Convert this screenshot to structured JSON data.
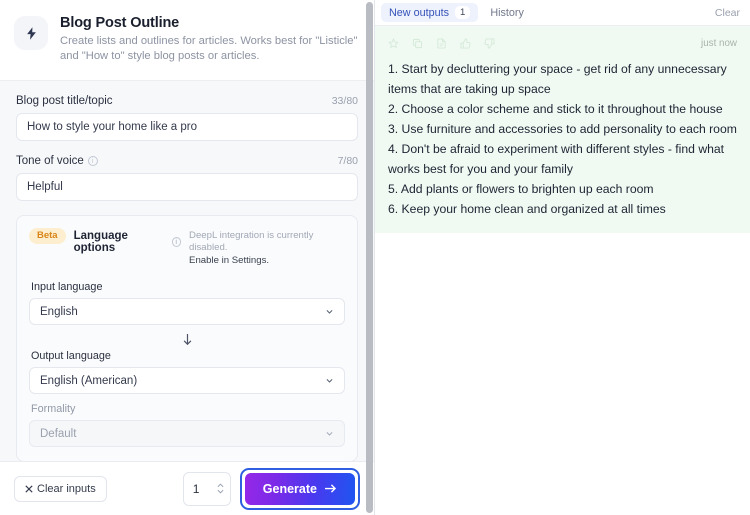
{
  "template": {
    "icon": "lightning-bolt-icon",
    "title": "Blog Post Outline",
    "description": "Create lists and outlines for articles. Works best for \"Listicle\" and \"How to\" style blog posts or articles."
  },
  "form": {
    "title_field": {
      "label": "Blog post title/topic",
      "counter": "33/80",
      "value": "How to style your home like a pro",
      "placeholder": "How to style your home like a pro"
    },
    "tone_field": {
      "label": "Tone of voice",
      "counter": "7/80",
      "value": "Helpful",
      "placeholder": "Helpful",
      "info_icon": "info-circle-icon"
    },
    "language_options": {
      "badge": "Beta",
      "title": "Language options",
      "info_icon": "info-circle-icon",
      "note_line1": "DeepL integration is currently disabled.",
      "note_line2": "Enable in Settings.",
      "input_language": {
        "label": "Input language",
        "value": "English",
        "chevron": "chevron-down-icon"
      },
      "transfer_arrow": "arrow-down-icon",
      "output_language": {
        "label": "Output language",
        "value": "English (American)",
        "chevron": "chevron-down-icon"
      },
      "formality": {
        "label": "Formality",
        "value": "Default",
        "chevron": "chevron-down-icon"
      }
    }
  },
  "footer": {
    "clear_inputs_label": "Clear inputs",
    "clear_icon": "close-x-icon",
    "count_value": "1",
    "stepper_icon": "stepper-updown-icon",
    "generate_label": "Generate",
    "generate_arrow": "arrow-right-icon",
    "generate_gradient_from": "#9628e8",
    "generate_gradient_to": "#1f55f0",
    "focus_ring_color": "#2f5fe0"
  },
  "output_panel": {
    "tabs": [
      {
        "label": "New outputs",
        "badge": "1",
        "active": true
      },
      {
        "label": "History",
        "badge": "",
        "active": false
      }
    ],
    "clear_label": "Clear",
    "card": {
      "background": "#f0faf2",
      "timestamp": "just now",
      "toolbar_icons": [
        "star-icon",
        "copy-icon",
        "document-icon",
        "thumbs-up-icon",
        "thumbs-down-icon"
      ],
      "lines": [
        "1. Start by decluttering your space - get rid of any unnecessary items that are taking up space",
        "2. Choose a color scheme and stick to it throughout the house",
        "3. Use furniture and accessories to add personality to each room",
        "4. Don't be afraid to experiment with different styles - find what works best for you and your family",
        "5. Add plants or flowers to brighten up each room",
        "6. Keep your home clean and organized at all times"
      ]
    }
  }
}
